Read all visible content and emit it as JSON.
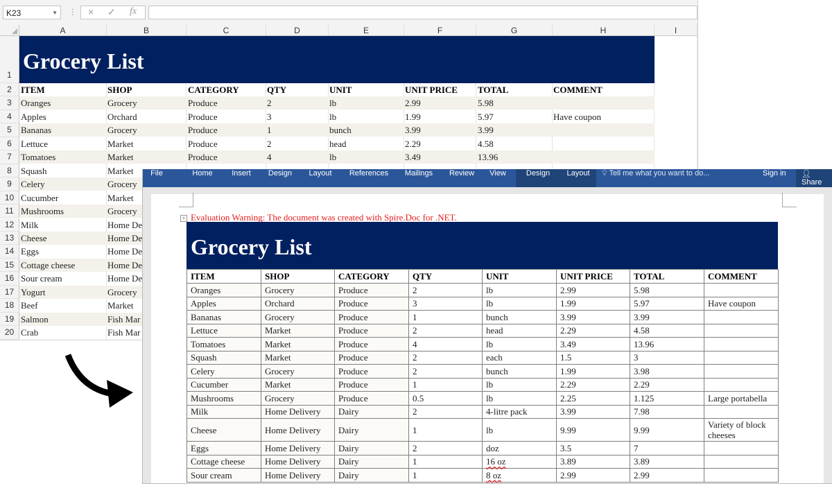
{
  "excel": {
    "name_box": "K23",
    "formula_bar": {
      "cancel_icon": "×",
      "enter_icon": "✓",
      "function_label": "fx",
      "value": ""
    },
    "columns": [
      "A",
      "B",
      "C",
      "D",
      "E",
      "F",
      "G",
      "H",
      "I"
    ],
    "row_numbers": [
      "1",
      "2",
      "3",
      "4",
      "5",
      "6",
      "7",
      "8",
      "9",
      "10",
      "11",
      "12",
      "13",
      "14",
      "15",
      "16",
      "17",
      "18",
      "19",
      "20"
    ],
    "title": "Grocery List",
    "headers": [
      "ITEM",
      "SHOP",
      "CATEGORY",
      "QTY",
      "UNIT",
      "UNIT PRICE",
      "TOTAL",
      "COMMENT"
    ],
    "rows": [
      [
        "Oranges",
        "Grocery",
        "Produce",
        "2",
        "lb",
        "2.99",
        "5.98",
        ""
      ],
      [
        "Apples",
        "Orchard",
        "Produce",
        "3",
        "lb",
        "1.99",
        "5.97",
        "Have coupon"
      ],
      [
        "Bananas",
        "Grocery",
        "Produce",
        "1",
        "bunch",
        "3.99",
        "3.99",
        ""
      ],
      [
        "Lettuce",
        "Market",
        "Produce",
        "2",
        "head",
        "2.29",
        "4.58",
        ""
      ],
      [
        "Tomatoes",
        "Market",
        "Produce",
        "4",
        "lb",
        "3.49",
        "13.96",
        ""
      ],
      [
        "Squash",
        "Market",
        "",
        "",
        "",
        "",
        "",
        ""
      ],
      [
        "Celery",
        "Grocery",
        "",
        "",
        "",
        "",
        "",
        ""
      ],
      [
        "Cucumber",
        "Market",
        "",
        "",
        "",
        "",
        "",
        ""
      ],
      [
        "Mushrooms",
        "Grocery",
        "",
        "",
        "",
        "",
        "",
        ""
      ],
      [
        "Milk",
        "Home De",
        "",
        "",
        "",
        "",
        "",
        ""
      ],
      [
        "Cheese",
        "Home De",
        "",
        "",
        "",
        "",
        "",
        ""
      ],
      [
        "Eggs",
        "Home De",
        "",
        "",
        "",
        "",
        "",
        ""
      ],
      [
        "Cottage cheese",
        "Home De",
        "",
        "",
        "",
        "",
        "",
        ""
      ],
      [
        "Sour cream",
        "Home De",
        "",
        "",
        "",
        "",
        "",
        ""
      ],
      [
        "Yogurt",
        "Grocery",
        "",
        "",
        "",
        "",
        "",
        ""
      ],
      [
        "Beef",
        "Market",
        "",
        "",
        "",
        "",
        "",
        ""
      ],
      [
        "Salmon",
        "Fish Mar",
        "",
        "",
        "",
        "",
        "",
        ""
      ],
      [
        "Crab",
        "Fish Mar",
        "",
        "",
        "",
        "",
        "",
        ""
      ]
    ]
  },
  "word": {
    "tabs": [
      "File",
      "Home",
      "Insert",
      "Design",
      "Layout",
      "References",
      "Mailings",
      "Review",
      "View",
      "Design",
      "Layout"
    ],
    "tell_me": "Tell me what you want to do...",
    "sign_in": "Sign in",
    "share": "Share",
    "warning": "Evaluation Warning: The document was created with Spire.Doc for .NET.",
    "title": "Grocery List",
    "headers": [
      "ITEM",
      "SHOP",
      "CATEGORY",
      "QTY",
      "UNIT",
      "UNIT PRICE",
      "TOTAL",
      "COMMENT"
    ],
    "rows": [
      [
        "Oranges",
        "Grocery",
        "Produce",
        "2",
        "lb",
        "2.99",
        "5.98",
        ""
      ],
      [
        "Apples",
        "Orchard",
        "Produce",
        "3",
        "lb",
        "1.99",
        "5.97",
        "Have coupon"
      ],
      [
        "Bananas",
        "Grocery",
        "Produce",
        "1",
        "bunch",
        "3.99",
        "3.99",
        ""
      ],
      [
        "Lettuce",
        "Market",
        "Produce",
        "2",
        "head",
        "2.29",
        "4.58",
        ""
      ],
      [
        "Tomatoes",
        "Market",
        "Produce",
        "4",
        "lb",
        "3.49",
        "13.96",
        ""
      ],
      [
        "Squash",
        "Market",
        "Produce",
        "2",
        "each",
        "1.5",
        "3",
        ""
      ],
      [
        "Celery",
        "Grocery",
        "Produce",
        "2",
        "bunch",
        "1.99",
        "3.98",
        ""
      ],
      [
        "Cucumber",
        "Market",
        "Produce",
        "1",
        "lb",
        "2.29",
        "2.29",
        ""
      ],
      [
        "Mushrooms",
        "Grocery",
        "Produce",
        "0.5",
        "lb",
        "2.25",
        "1.125",
        "Large portabella"
      ],
      [
        "Milk",
        "Home Delivery",
        "Dairy",
        "2",
        "4-litre pack",
        "3.99",
        "7.98",
        ""
      ],
      [
        "Cheese",
        "Home Delivery",
        "Dairy",
        "1",
        "lb",
        "9.99",
        "9.99",
        "Variety of block cheeses"
      ],
      [
        "Eggs",
        "Home Delivery",
        "Dairy",
        "2",
        "doz",
        "3.5",
        "7",
        ""
      ],
      [
        "Cottage cheese",
        "Home Delivery",
        "Dairy",
        "1",
        "16 oz",
        "3.89",
        "3.89",
        ""
      ],
      [
        "Sour cream",
        "Home Delivery",
        "Dairy",
        "1",
        "8 oz",
        "2.99",
        "2.99",
        ""
      ]
    ]
  },
  "colors": {
    "banner": "#002060",
    "ribbon": "#2b579a",
    "warning": "#e21b1b",
    "row_shade": "#f3f1ea"
  }
}
